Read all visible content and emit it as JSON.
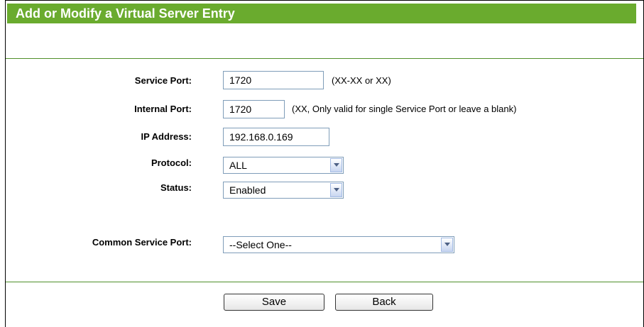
{
  "header": {
    "title": "Add or Modify a Virtual Server Entry"
  },
  "form": {
    "service_port": {
      "label": "Service Port:",
      "value": "1720",
      "hint": "(XX-XX or XX)"
    },
    "internal_port": {
      "label": "Internal Port:",
      "value": "1720",
      "hint": "(XX, Only valid for single Service Port or leave a blank)"
    },
    "ip_address": {
      "label": "IP Address:",
      "value": "192.168.0.169"
    },
    "protocol": {
      "label": "Protocol:",
      "value": "ALL"
    },
    "status": {
      "label": "Status:",
      "value": "Enabled"
    },
    "common_service_port": {
      "label": "Common Service Port:",
      "value": "--Select One--"
    }
  },
  "buttons": {
    "save": "Save",
    "back": "Back"
  },
  "colors": {
    "title_bar": "#6aab2e",
    "separator": "#4f8f2a"
  }
}
